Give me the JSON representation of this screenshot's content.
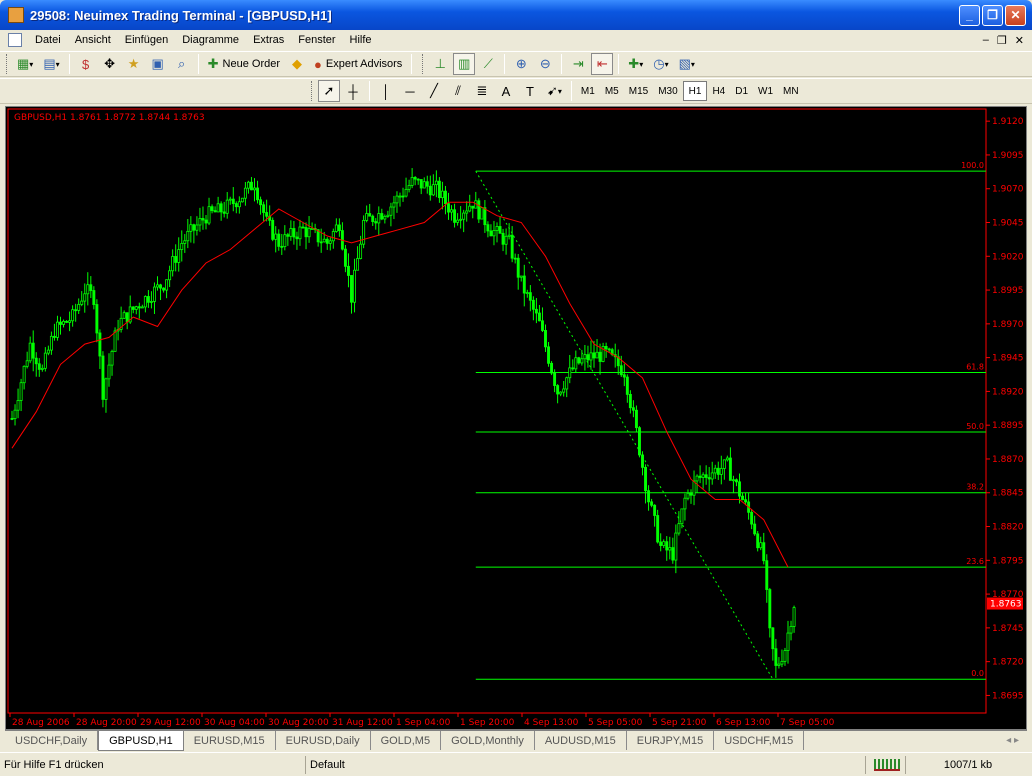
{
  "window": {
    "title": "29508: Neuimex Trading Terminal - [GBPUSD,H1]"
  },
  "menu": {
    "items": [
      "Datei",
      "Ansicht",
      "Einfügen",
      "Diagramme",
      "Extras",
      "Fenster",
      "Hilfe"
    ]
  },
  "toolbar1": {
    "neue_order": "Neue Order",
    "expert_advisors": "Expert Advisors"
  },
  "toolbar2": {
    "timeframes": [
      "M1",
      "M5",
      "M15",
      "M30",
      "H1",
      "H4",
      "D1",
      "W1",
      "MN"
    ],
    "active_timeframe": "H1"
  },
  "chart_data": {
    "type": "candlestick",
    "symbol_label": "GBPUSD,H1  1.8761 1.8772 1.8744 1.8763",
    "current_price": "1.8763",
    "colors": {
      "background": "#000000",
      "candles": "#00ff00",
      "axis": "#ff0000",
      "moving_average": "#ff0000",
      "fibonacci": "#00ff00",
      "price_tag": "#ff0000"
    },
    "ylim": [
      1.8682,
      1.9129
    ],
    "y_ticks": [
      "1.9120",
      "1.9095",
      "1.9070",
      "1.9045",
      "1.9020",
      "1.8995",
      "1.8970",
      "1.8945",
      "1.8920",
      "1.8895",
      "1.8870",
      "1.8845",
      "1.8820",
      "1.8795",
      "1.8770",
      "1.8745",
      "1.8720",
      "1.8695"
    ],
    "x_ticks": [
      "28 Aug 2006",
      "28 Aug 20:00",
      "29 Aug 12:00",
      "30 Aug 04:00",
      "30 Aug 20:00",
      "31 Aug 12:00",
      "1 Sep 04:00",
      "1 Sep 20:00",
      "4 Sep 13:00",
      "5 Sep 05:00",
      "5 Sep 21:00",
      "6 Sep 13:00",
      "7 Sep 05:00"
    ],
    "price_path": [
      [
        0,
        1.89
      ],
      [
        6,
        1.8955
      ],
      [
        10,
        1.8935
      ],
      [
        14,
        1.8965
      ],
      [
        20,
        1.8975
      ],
      [
        24,
        1.8995
      ],
      [
        27,
        1.899
      ],
      [
        30,
        1.892
      ],
      [
        35,
        1.897
      ],
      [
        42,
        1.8985
      ],
      [
        50,
        1.9
      ],
      [
        56,
        1.903
      ],
      [
        64,
        1.905
      ],
      [
        70,
        1.9055
      ],
      [
        76,
        1.9065
      ],
      [
        80,
        1.9075
      ],
      [
        84,
        1.9045
      ],
      [
        88,
        1.903
      ],
      [
        96,
        1.904
      ],
      [
        104,
        1.903
      ],
      [
        108,
        1.9045
      ],
      [
        112,
        1.899
      ],
      [
        116,
        1.9045
      ],
      [
        124,
        1.9055
      ],
      [
        132,
        1.9075
      ],
      [
        140,
        1.907
      ],
      [
        146,
        1.905
      ],
      [
        152,
        1.906
      ],
      [
        158,
        1.904
      ],
      [
        164,
        1.903
      ],
      [
        168,
        1.9
      ],
      [
        174,
        1.897
      ],
      [
        180,
        1.892
      ],
      [
        186,
        1.894
      ],
      [
        190,
        1.8945
      ],
      [
        196,
        1.8948
      ],
      [
        202,
        1.8935
      ],
      [
        206,
        1.889
      ],
      [
        210,
        1.884
      ],
      [
        214,
        1.8805
      ],
      [
        218,
        1.88
      ],
      [
        222,
        1.884
      ],
      [
        226,
        1.8855
      ],
      [
        230,
        1.886
      ],
      [
        236,
        1.8865
      ],
      [
        240,
        1.8845
      ],
      [
        244,
        1.8825
      ],
      [
        248,
        1.8795
      ],
      [
        250,
        1.874
      ],
      [
        252,
        1.8715
      ],
      [
        255,
        1.873
      ],
      [
        258,
        1.8763
      ]
    ],
    "moving_average": [
      [
        0,
        1.8878
      ],
      [
        8,
        1.8905
      ],
      [
        16,
        1.894
      ],
      [
        24,
        1.8955
      ],
      [
        32,
        1.896
      ],
      [
        40,
        1.8975
      ],
      [
        48,
        1.8968
      ],
      [
        56,
        1.8995
      ],
      [
        64,
        1.9015
      ],
      [
        72,
        1.9025
      ],
      [
        80,
        1.904
      ],
      [
        88,
        1.9055
      ],
      [
        96,
        1.9045
      ],
      [
        104,
        1.9035
      ],
      [
        112,
        1.903
      ],
      [
        120,
        1.9035
      ],
      [
        128,
        1.904
      ],
      [
        136,
        1.9045
      ],
      [
        144,
        1.906
      ],
      [
        152,
        1.906
      ],
      [
        160,
        1.905
      ],
      [
        168,
        1.9045
      ],
      [
        176,
        1.902
      ],
      [
        184,
        1.8985
      ],
      [
        192,
        1.8955
      ],
      [
        200,
        1.8945
      ],
      [
        208,
        1.893
      ],
      [
        216,
        1.889
      ],
      [
        224,
        1.8855
      ],
      [
        232,
        1.884
      ],
      [
        240,
        1.884
      ],
      [
        248,
        1.8825
      ],
      [
        256,
        1.879
      ]
    ],
    "fibonacci": {
      "levels": [
        {
          "label": "100.0",
          "price": 1.9083
        },
        {
          "label": "61.8",
          "price": 1.8934
        },
        {
          "label": "50.0",
          "price": 1.889
        },
        {
          "label": "38.2",
          "price": 1.8845
        },
        {
          "label": "23.6",
          "price": 1.879
        },
        {
          "label": "0.0",
          "price": 1.8707
        }
      ],
      "x_start": 153,
      "x_end": 320,
      "anchor_high": [
        153,
        1.9083
      ],
      "anchor_low": [
        251,
        1.8707
      ]
    },
    "x_count": 320,
    "grid": false,
    "legend": "none"
  },
  "tabs": [
    "USDCHF,Daily",
    "GBPUSD,H1",
    "EURUSD,M15",
    "EURUSD,Daily",
    "GOLD,M5",
    "GOLD,Monthly",
    "AUDUSD,M15",
    "EURJPY,M15",
    "USDCHF,M15"
  ],
  "active_tab": "GBPUSD,H1",
  "status": {
    "help": "Für Hilfe F1 drücken",
    "profile": "Default",
    "traffic": "1007/1 kb"
  }
}
